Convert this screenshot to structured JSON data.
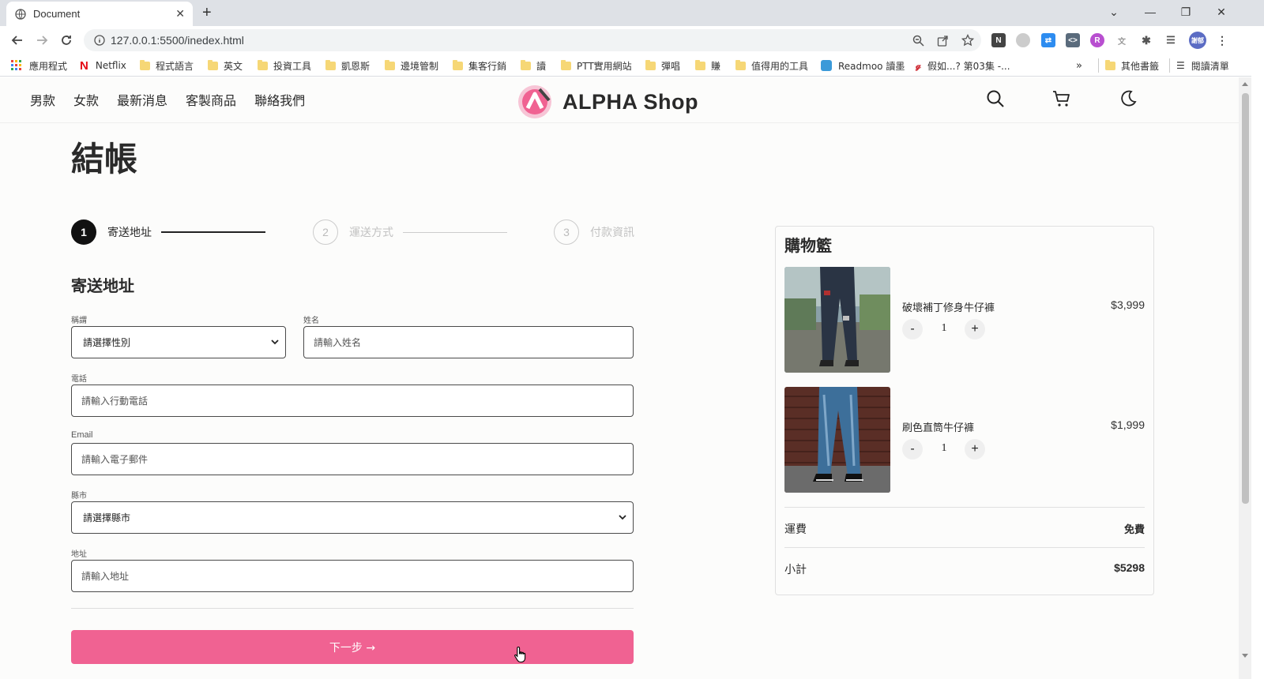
{
  "browser": {
    "tab_title": "Document",
    "url": "127.0.0.1:5500/inedex.html",
    "bookmarks": [
      "應用程式",
      "Netflix",
      "程式語言",
      "英文",
      "投資工具",
      "凱恩斯",
      "邊境管制",
      "集客行銷",
      "讀",
      "PTT實用網站",
      "彈唱",
      "賺",
      "值得用的工具",
      "Readmoo 讀墨",
      "假如...? 第03集 -...",
      "»",
      "其他書籤",
      "閱讀清單"
    ],
    "profile_label": "謝郁"
  },
  "site": {
    "nav": [
      "男款",
      "女款",
      "最新消息",
      "客製商品",
      "聯絡我們"
    ],
    "brand": "ALPHA Shop"
  },
  "checkout": {
    "title": "結帳",
    "steps": [
      {
        "num": "1",
        "label": "寄送地址",
        "state": "active"
      },
      {
        "num": "2",
        "label": "運送方式",
        "state": "inactive"
      },
      {
        "num": "3",
        "label": "付款資訊",
        "state": "inactive"
      }
    ],
    "section_title": "寄送地址",
    "form": {
      "salutation_label": "稱謂",
      "salutation_value": "請選擇性別",
      "name_label": "姓名",
      "name_placeholder": "請輸入姓名",
      "phone_label": "電話",
      "phone_placeholder": "請輸入行動電話",
      "email_label": "Email",
      "email_placeholder": "請輸入電子郵件",
      "city_label": "縣市",
      "city_value": "請選擇縣市",
      "address_label": "地址",
      "address_placeholder": "請輸入地址"
    },
    "next_button": "下一步 →"
  },
  "cart": {
    "title": "購物籃",
    "items": [
      {
        "name": "破壞補丁修身牛仔褲",
        "price": "$3,999",
        "qty": "1"
      },
      {
        "name": "刷色直筒牛仔褲",
        "price": "$1,999",
        "qty": "1"
      }
    ],
    "minus": "-",
    "plus": "+",
    "shipping_label": "運費",
    "shipping_value": "免費",
    "subtotal_label": "小計",
    "subtotal_value": "$5298"
  },
  "colors": {
    "accent": "#f06292",
    "step_active": "#111111",
    "border": "#4a4a4a"
  }
}
